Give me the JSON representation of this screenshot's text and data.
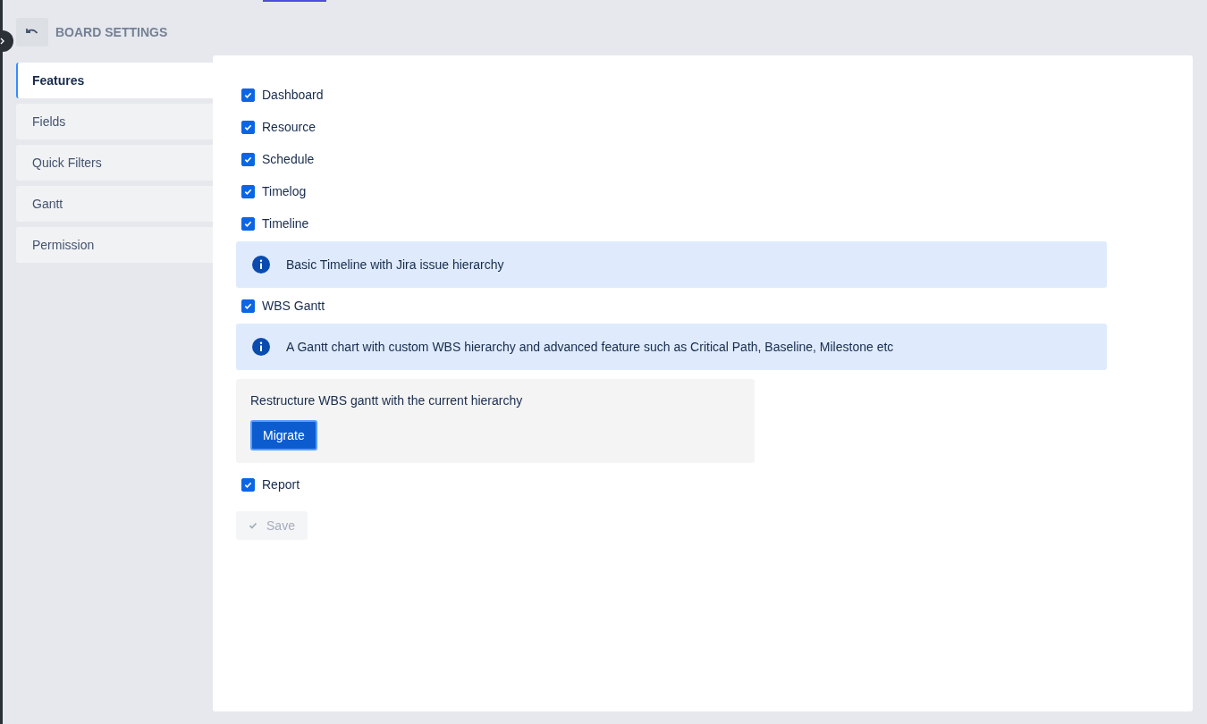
{
  "header": {
    "title": "BOARD SETTINGS"
  },
  "sidebar": {
    "items": [
      {
        "label": "Features",
        "selected": true
      },
      {
        "label": "Fields",
        "selected": false
      },
      {
        "label": "Quick Filters",
        "selected": false
      },
      {
        "label": "Gantt",
        "selected": false
      },
      {
        "label": "Permission",
        "selected": false
      }
    ]
  },
  "features": [
    {
      "kind": "checkbox",
      "label": "Dashboard",
      "checked": true
    },
    {
      "kind": "checkbox",
      "label": "Resource",
      "checked": true
    },
    {
      "kind": "checkbox",
      "label": "Schedule",
      "checked": true
    },
    {
      "kind": "checkbox",
      "label": "Timelog",
      "checked": true
    },
    {
      "kind": "checkbox",
      "label": "Timeline",
      "checked": true
    },
    {
      "kind": "info",
      "text": "Basic Timeline with Jira issue hierarchy"
    },
    {
      "kind": "checkbox",
      "label": "WBS Gantt",
      "checked": true
    },
    {
      "kind": "info",
      "text": "A Gantt chart with custom WBS hierarchy and advanced feature such as Critical Path, Baseline, Milestone etc"
    },
    {
      "kind": "migrate",
      "text": "Restructure WBS gantt with the current hierarchy",
      "button": "Migrate"
    },
    {
      "kind": "checkbox",
      "label": "Report",
      "checked": true
    }
  ],
  "save_button": {
    "label": "Save",
    "disabled": true
  }
}
